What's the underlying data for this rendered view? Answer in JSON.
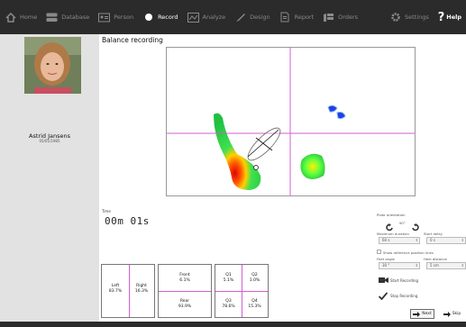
{
  "nav": {
    "home": "Home",
    "database": "Database",
    "person": "Person",
    "record": "Record",
    "analyze": "Analyze",
    "design": "Design",
    "report": "Report",
    "orders": "Orders",
    "settings": "Settings",
    "help": "Help"
  },
  "patient": {
    "name": "Astrid Jansens",
    "dob": "05/01/1985"
  },
  "page": {
    "title": "Balance recording"
  },
  "timer": {
    "label": "Time",
    "value": "00m 01s"
  },
  "stats": {
    "left_label": "Left",
    "left_value": "83.7%",
    "right_label": "Right",
    "right_value": "16.3%",
    "front_label": "Front",
    "front_value": "6.1%",
    "rear_label": "Rear",
    "rear_value": "93.9%",
    "q1_label": "Q1",
    "q1_value": "5.1%",
    "q2_label": "Q2",
    "q2_value": "1.0%",
    "q3_label": "Q3",
    "q3_value": "78.6%",
    "q4_label": "Q4",
    "q4_value": "15.3%"
  },
  "settings": {
    "plate_orientation": "Plate orientation",
    "rotation": "90°",
    "max_duration_label": "Maximum duration",
    "max_duration_value": "60 s",
    "start_delay_label": "Start delay",
    "start_delay_value": "0 s",
    "show_ref_lines": "Show reference position lines",
    "feet_angle_label": "Feet angle",
    "feet_angle_value": "30 °",
    "heel_distance_label": "Heel distance",
    "heel_distance_value": "5 cm",
    "start_recording": "Start Recording",
    "stop_recording": "Stop Recording",
    "next": "Next",
    "skip": "Skip"
  },
  "colors": {
    "toolbar": "#2b2b2b",
    "crosshair": "#d060d0",
    "accent": "#ffffff"
  }
}
